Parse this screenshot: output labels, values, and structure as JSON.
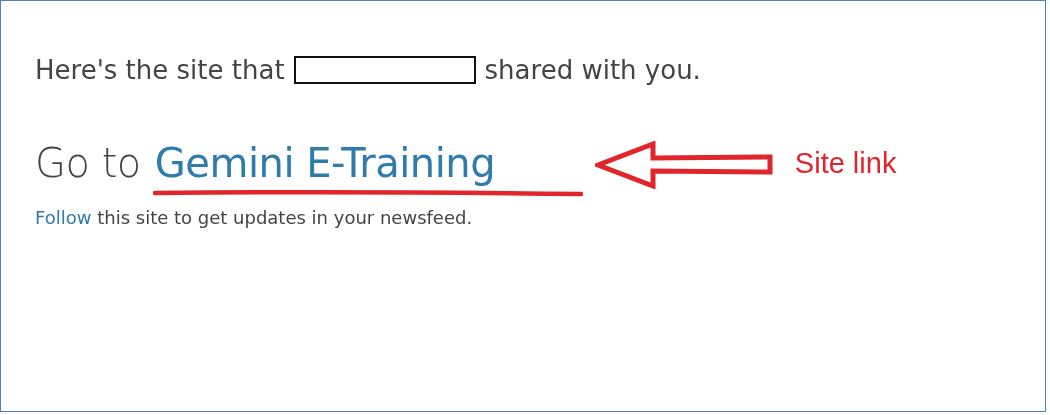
{
  "share_message": {
    "before": "Here's the site that",
    "after": "shared with you."
  },
  "heading": {
    "prefix": "Go to",
    "link": "Gemini E-Training"
  },
  "annotation": {
    "label": "Site link"
  },
  "follow": {
    "link": "Follow",
    "text": "this site to get updates in your newsfeed."
  }
}
